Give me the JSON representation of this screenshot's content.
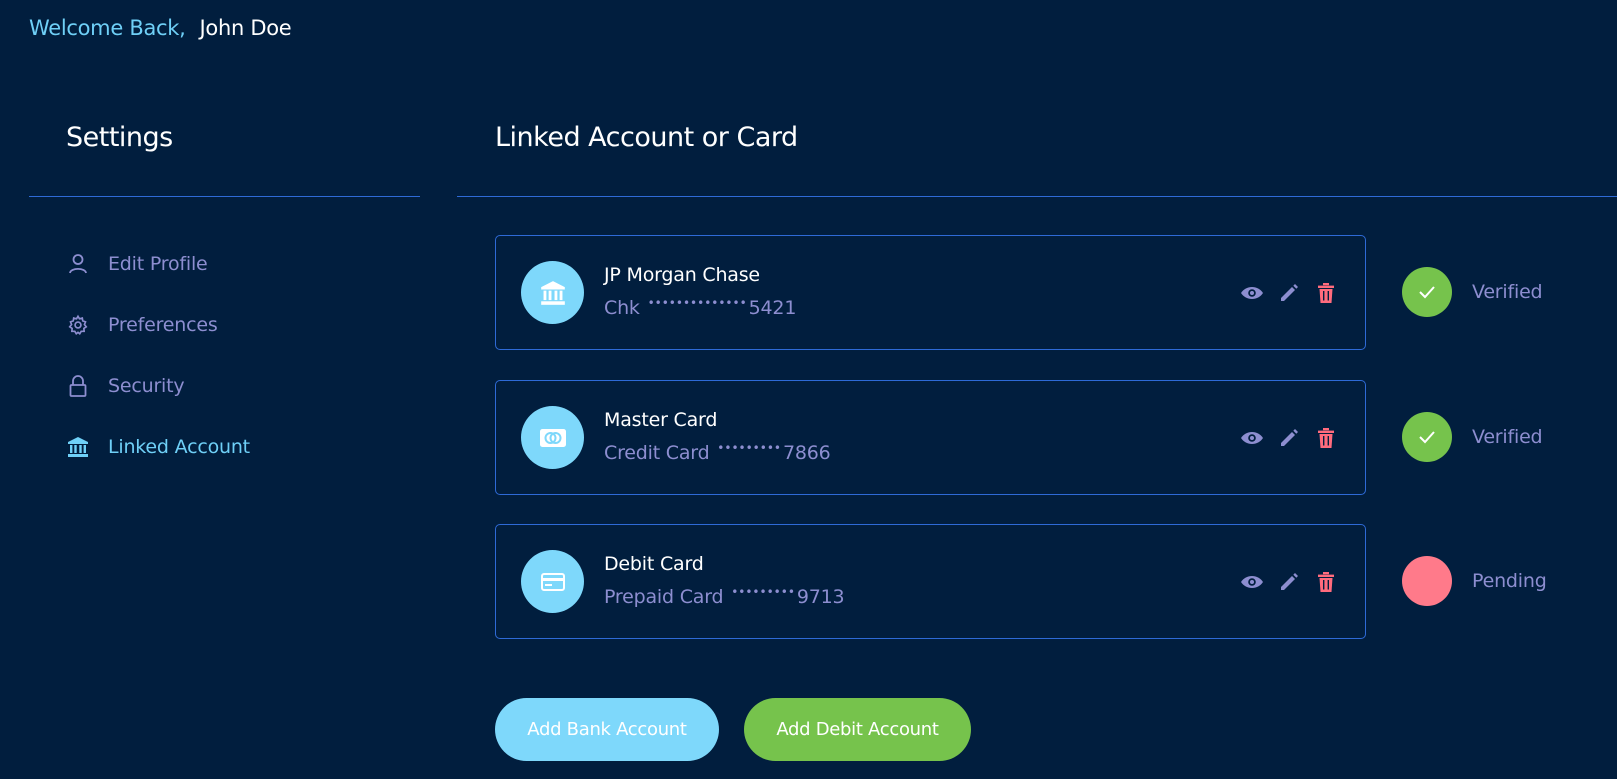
{
  "header": {
    "welcome": "Welcome Back,",
    "user_name": "John Doe"
  },
  "sidebar": {
    "title": "Settings",
    "items": [
      {
        "label": "Edit Profile",
        "icon": "user-icon",
        "active": false
      },
      {
        "label": "Preferences",
        "icon": "gear-icon",
        "active": false
      },
      {
        "label": "Security",
        "icon": "lock-icon",
        "active": false
      },
      {
        "label": "Linked Account",
        "icon": "bank-icon",
        "active": true
      }
    ]
  },
  "main": {
    "title": "Linked Account or Card",
    "accounts": [
      {
        "name": "JP Morgan Chase",
        "type": "Chk",
        "mask": "••••••••••••••",
        "last4": "5421",
        "icon": "bank-icon",
        "status": "Verified"
      },
      {
        "name": "Master Card",
        "type": "Credit Card",
        "mask": "•••••••••",
        "last4": "7866",
        "icon": "credit-card-icon",
        "status": "Verified"
      },
      {
        "name": "Debit Card",
        "type": "Prepaid Card",
        "mask": "•••••••••",
        "last4": "9713",
        "icon": "debit-card-icon",
        "status": "Pending"
      }
    ],
    "buttons": {
      "add_bank": "Add Bank Account",
      "add_debit": "Add Debit Account"
    }
  },
  "colors": {
    "background": "#011e3e",
    "accent_light_blue": "#7ed8fb",
    "accent_green": "#76c34c",
    "pending_pink": "#ff7a8a",
    "delete_red": "#ff6b7d",
    "muted_text": "#8d8ed0",
    "border_blue": "#2e6ad6"
  }
}
